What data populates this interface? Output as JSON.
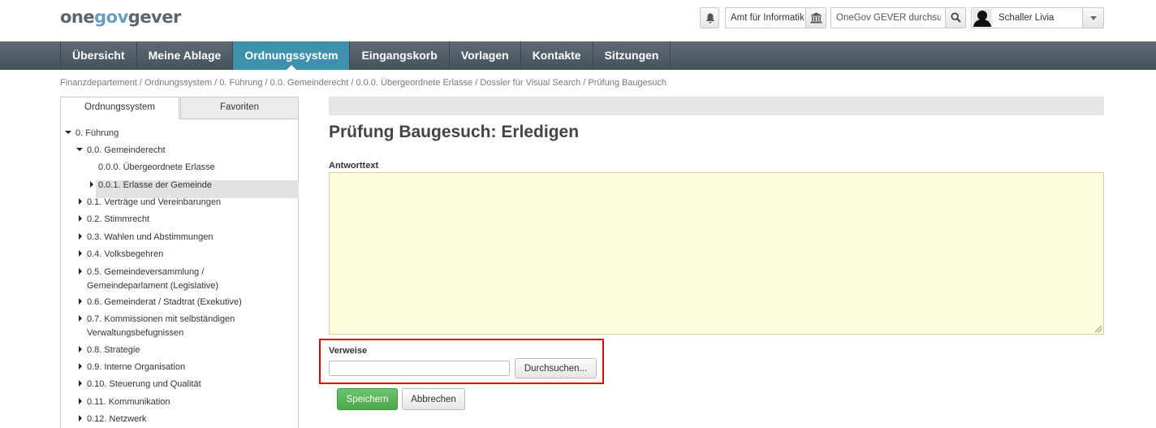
{
  "logo": {
    "part1": "one",
    "part2": "gov",
    "part3": "gever"
  },
  "header": {
    "org_label": "Amt für Informatik",
    "search_placeholder": "OneGov GEVER durchsuc",
    "user_name": "Schaller Livia"
  },
  "nav": {
    "items": [
      {
        "label": "Übersicht"
      },
      {
        "label": "Meine Ablage"
      },
      {
        "label": "Ordnungssystem",
        "active": true
      },
      {
        "label": "Eingangskorb"
      },
      {
        "label": "Vorlagen"
      },
      {
        "label": "Kontakte"
      },
      {
        "label": "Sitzungen"
      }
    ]
  },
  "breadcrumb": [
    "Finanzdepartement",
    "Ordnungssystem",
    "0. Führung",
    "0.0. Gemeinderecht",
    "0.0.0. Übergeordnete Erlasse",
    "Dossier für Visual Search",
    "Prüfung Baugesuch"
  ],
  "sidebar": {
    "tabs": [
      "Ordnungssystem",
      "Favoriten"
    ],
    "tree": [
      {
        "label": "0. Führung",
        "state": "open"
      },
      {
        "label": "0.0. Gemeinderecht",
        "state": "open"
      },
      {
        "label": "0.0.0. Übergeordnete Erlasse",
        "state": "none",
        "selected": true
      },
      {
        "label": "0.0.1. Erlasse der Gemeinde",
        "state": "closed"
      },
      {
        "label": "0.1. Verträge und Vereinbarungen",
        "state": "closed"
      },
      {
        "label": "0.2. Stimmrecht",
        "state": "closed"
      },
      {
        "label": "0.3. Wahlen und Abstimmungen",
        "state": "closed"
      },
      {
        "label": "0.4. Volksbegehren",
        "state": "closed"
      },
      {
        "label": "0.5. Gemeindeversammlung /",
        "label2": "Gemeindeparlament (Legislative)",
        "state": "closed"
      },
      {
        "label": "0.6. Gemeinderat / Stadtrat (Exekutive)",
        "state": "closed"
      },
      {
        "label": "0.7. Kommissionen mit selbständigen",
        "label2": "Verwaltungsbefugnissen",
        "state": "closed"
      },
      {
        "label": "0.8. Strategie",
        "state": "closed"
      },
      {
        "label": "0.9. Interne Organisation",
        "state": "closed"
      },
      {
        "label": "0.10. Steuerung und Qualität",
        "state": "closed"
      },
      {
        "label": "0.11. Kommunikation",
        "state": "closed"
      },
      {
        "label": "0.12. Netzwerk",
        "state": "closed"
      }
    ]
  },
  "main": {
    "title": "Prüfung Baugesuch: Erledigen",
    "antwort_label": "Antworttext",
    "antwort_value": "",
    "verweise_label": "Verweise",
    "verweise_value": "",
    "browse_label": "Durchsuchen...",
    "save_label": "Speichern",
    "cancel_label": "Abbrechen"
  },
  "colors": {
    "nav_active": "#3d91ad",
    "save_button": "#4aa84a",
    "highlight_border": "#e00000",
    "textarea_bg": "#fefde0"
  }
}
